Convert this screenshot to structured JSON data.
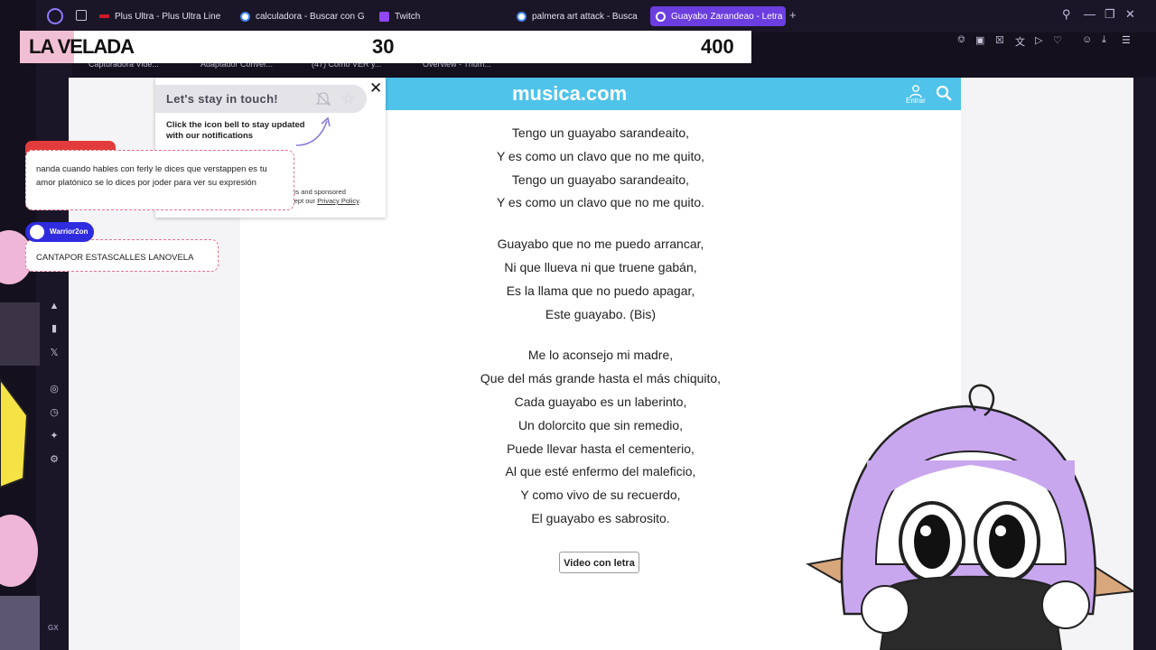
{
  "tabs": [
    {
      "label": "Plus Ultra - Plus Ultra Line",
      "favicon_color": "#d1172a"
    },
    {
      "label": "calculadora - Buscar con G",
      "favicon_color": "#4285f4"
    },
    {
      "label": "Twitch",
      "favicon_color": "#9146ff"
    },
    {
      "label": "palmera art attack - Busca",
      "favicon_color": "#4285f4"
    },
    {
      "label": "Guayabo Zarandeao - Letra",
      "favicon_color": "#ffffff",
      "active": true
    }
  ],
  "bookmarks": [
    "Capturadora Vide...",
    "Adaptador Conver...",
    "(47) Cómo VER y...",
    "Overview - Thum..."
  ],
  "overlay": {
    "title": "LA VELADA",
    "score_left": "30",
    "score_right": "400"
  },
  "site": {
    "title": "musica.com",
    "login_label": "Entrar"
  },
  "popup": {
    "title": "Let's stay in touch!",
    "text": "Click the icon bell to stay updated with our notifications",
    "fine_print": "ws and sponsored",
    "fine_print_2": "cept our",
    "privacy_link": "Privacy Policy"
  },
  "lyrics": [
    [
      "Tengo un guayabo sarandeaito,",
      "Y es como un clavo que no me quito,",
      "Tengo un guayabo sarandeaito,",
      "Y es como un clavo que no me quito."
    ],
    [
      "Guayabo que no me puedo arrancar,",
      "Ni que llueva ni que truene gabán,",
      "Es la llama que no puedo apagar,",
      "Este guayabo. (Bis)"
    ],
    [
      "Me lo aconsejo mi madre,",
      "Que del más grande hasta el más chiquito,",
      "Cada guayabo es un laberinto,",
      "Un dolorcito que sin remedio,",
      "Puede llevar hasta el cementerio,",
      "Al que esté enfermo del maleficio,",
      "Y como vivo de su recuerdo,",
      "El guayabo es sabrosito."
    ]
  ],
  "video_button": "Video con letra",
  "chat": [
    {
      "user": "",
      "text": "nanda cuando hables con ferly le dices que verstappen es tu amor platónico se lo dices por joder para ver su expresión"
    },
    {
      "user": "Warrior2on",
      "text": "CANTAPOR ESTASCALLES LANOVELA"
    }
  ],
  "sidebar_label": "GX",
  "colors": {
    "accent": "#6c3ee0",
    "site_header": "#4fc3ea",
    "chat_border": "#e8708f"
  }
}
